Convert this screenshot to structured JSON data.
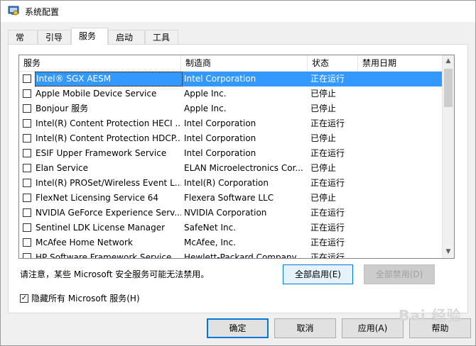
{
  "window": {
    "title": "系统配置"
  },
  "tabs": [
    {
      "label": "常规"
    },
    {
      "label": "引导"
    },
    {
      "label": "服务"
    },
    {
      "label": "启动"
    },
    {
      "label": "工具"
    }
  ],
  "columns": [
    "服务",
    "制造商",
    "状态",
    "禁用日期"
  ],
  "services": [
    {
      "name": "Intel® SGX AESM",
      "vendor": "Intel Corporation",
      "status": "正在运行",
      "disabled_date": "",
      "checked": false,
      "selected": true
    },
    {
      "name": "Apple Mobile Device Service",
      "vendor": "Apple Inc.",
      "status": "已停止",
      "disabled_date": "",
      "checked": false
    },
    {
      "name": "Bonjour 服务",
      "vendor": "Apple Inc.",
      "status": "已停止",
      "disabled_date": "",
      "checked": false
    },
    {
      "name": "Intel(R) Content Protection HECI ...",
      "vendor": "Intel Corporation",
      "status": "正在运行",
      "disabled_date": "",
      "checked": false
    },
    {
      "name": "Intel(R) Content Protection HDCP...",
      "vendor": "Intel Corporation",
      "status": "已停止",
      "disabled_date": "",
      "checked": false
    },
    {
      "name": "ESIF Upper Framework Service",
      "vendor": "Intel Corporation",
      "status": "正在运行",
      "disabled_date": "",
      "checked": false
    },
    {
      "name": "Elan Service",
      "vendor": "ELAN Microelectronics Cor...",
      "status": "已停止",
      "disabled_date": "",
      "checked": false
    },
    {
      "name": "Intel(R) PROSet/Wireless Event L...",
      "vendor": "Intel(R) Corporation",
      "status": "正在运行",
      "disabled_date": "",
      "checked": false
    },
    {
      "name": "FlexNet Licensing Service 64",
      "vendor": "Flexera Software LLC",
      "status": "已停止",
      "disabled_date": "",
      "checked": false
    },
    {
      "name": "NVIDIA GeForce Experience Serv...",
      "vendor": "NVIDIA Corporation",
      "status": "正在运行",
      "disabled_date": "",
      "checked": false
    },
    {
      "name": "Sentinel LDK License Manager",
      "vendor": "SafeNet Inc.",
      "status": "正在运行",
      "disabled_date": "",
      "checked": false
    },
    {
      "name": "McAfee Home Network",
      "vendor": "McAfee, Inc.",
      "status": "正在运行",
      "disabled_date": "",
      "checked": false
    },
    {
      "name": "HP Software Framework Service",
      "vendor": "Hewlett-Packard Company",
      "status": "正在运行",
      "disabled_date": "",
      "checked": false
    }
  ],
  "note": "请注意，某些 Microsoft 安全服务可能无法禁用。",
  "buttons": {
    "enable_all": "全部启用(E)",
    "disable_all": "全部禁用(D)",
    "ok": "确定",
    "cancel": "取消",
    "apply": "应用(A)",
    "help": "帮助"
  },
  "hide_ms": {
    "label": "隐藏所有 Microsoft 服务(H)",
    "checked": true,
    "mark": "✓"
  },
  "watermark": "Bai 经验",
  "icons": {
    "app": "msconfig-icon",
    "scroll_up": "▲",
    "scroll_down": "▼"
  }
}
